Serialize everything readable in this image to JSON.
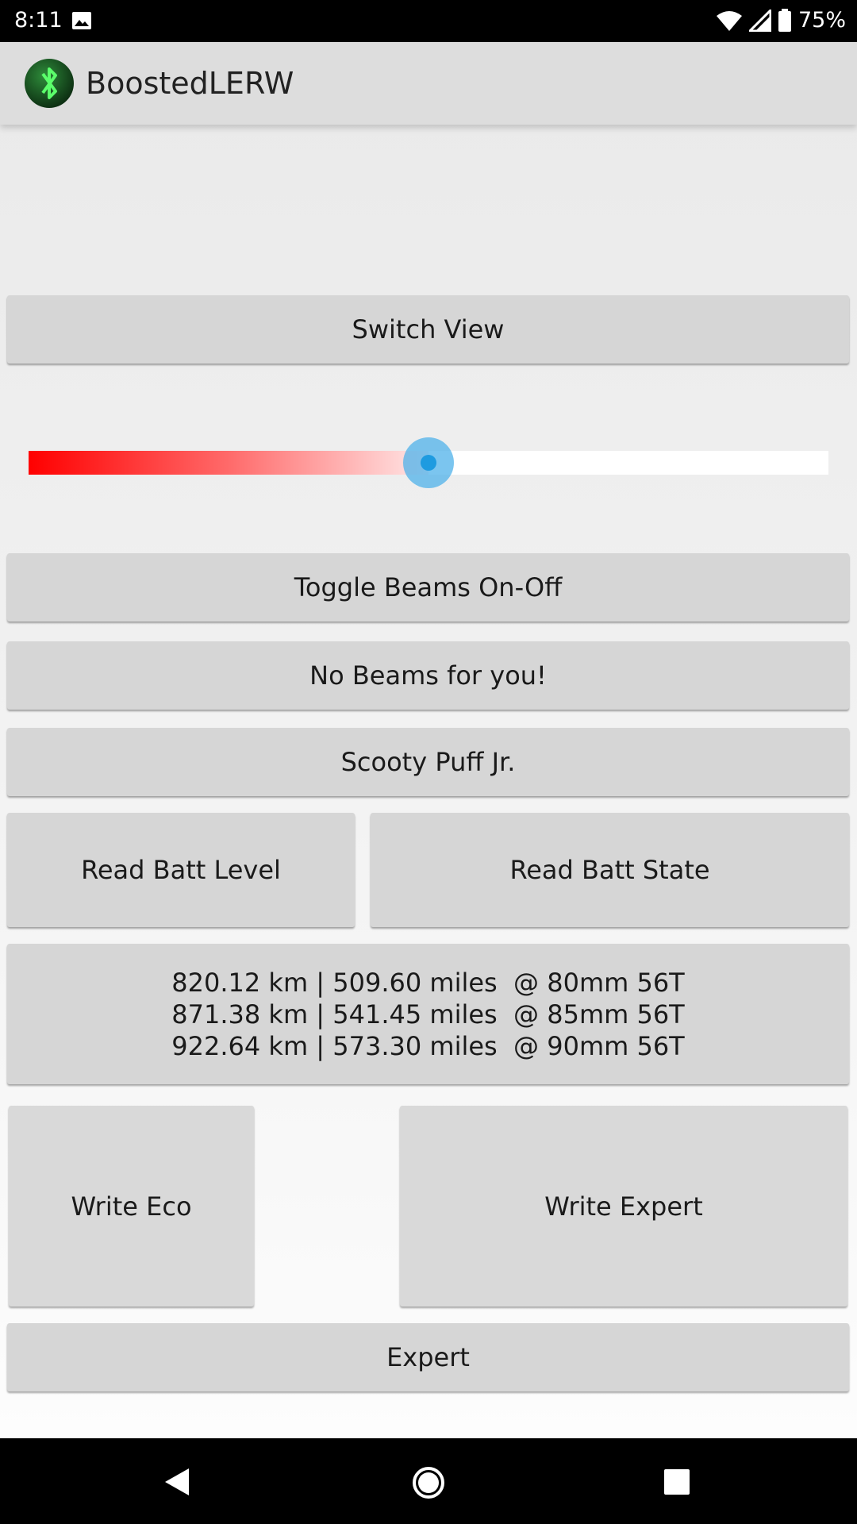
{
  "status_bar": {
    "time": "8:11",
    "battery_percent": "75%",
    "icons": [
      "photo-icon",
      "wifi-icon",
      "signal-icon",
      "battery-icon"
    ]
  },
  "app_bar": {
    "title": "BoostedLERW",
    "logo_icon": "bluetooth-icon"
  },
  "buttons": {
    "switch_view": "Switch View",
    "toggle_beams": "Toggle Beams On-Off",
    "no_beams": "No Beams for you!",
    "scooty_puff": "Scooty Puff Jr.",
    "read_batt_level": "Read Batt Level",
    "read_batt_state": "Read Batt State",
    "odometer": [
      "820.12 km | 509.60 miles  @ 80mm 56T",
      "871.38 km | 541.45 miles  @ 85mm 56T",
      "922.64 km | 573.30 miles  @ 90mm 56T"
    ],
    "write_eco": "Write Eco",
    "write_expert": "Write Expert",
    "expert": "Expert"
  },
  "slider": {
    "value_fraction": 0.5,
    "fill_colors": [
      "#ff0000",
      "#ffe8e8"
    ],
    "thumb_color": "#1e9be0"
  },
  "nav_bar": {
    "icons": [
      "back-icon",
      "home-icon",
      "recents-icon"
    ]
  }
}
